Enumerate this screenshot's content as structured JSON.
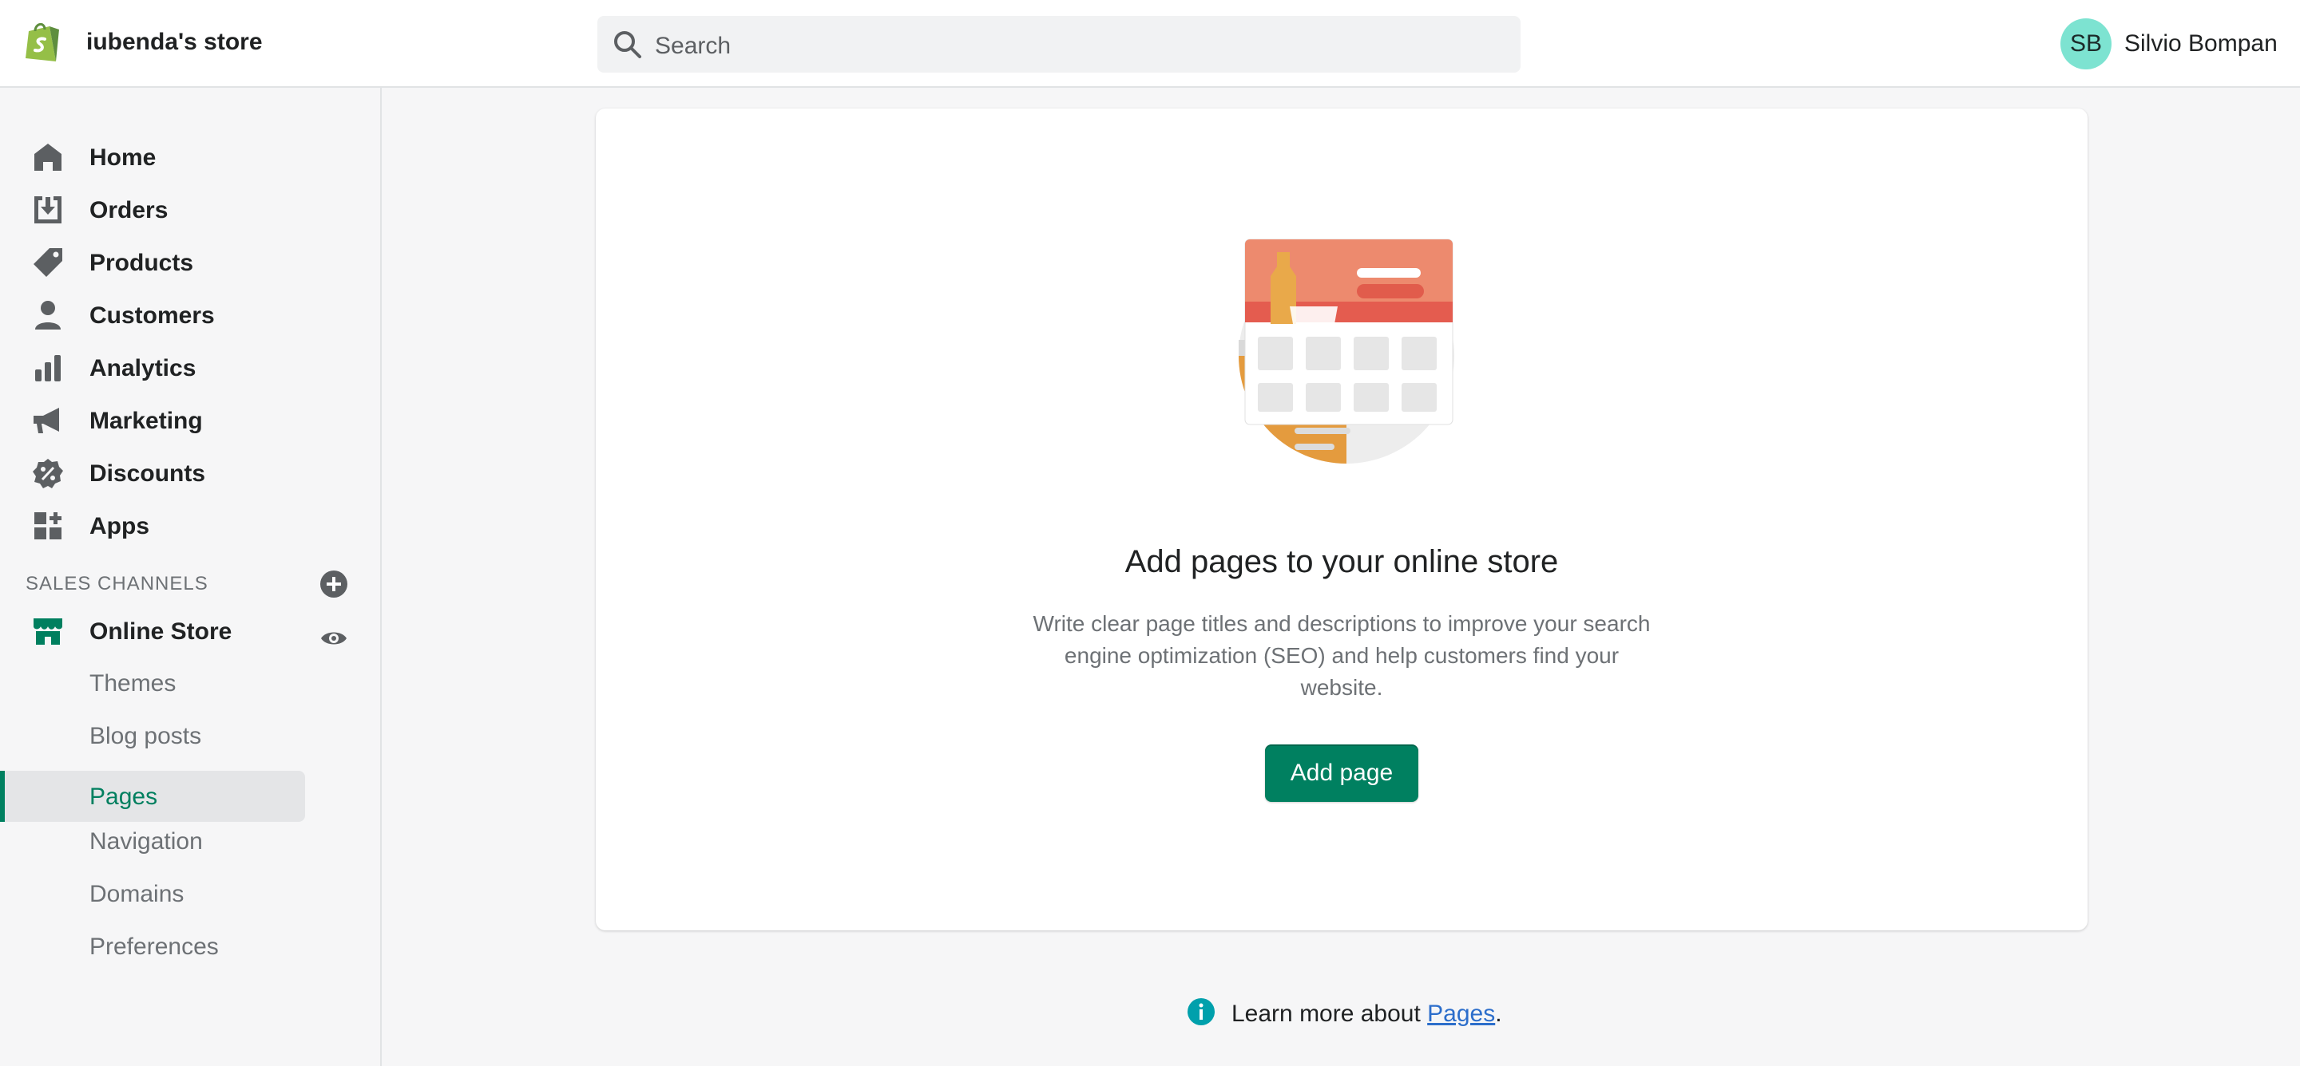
{
  "header": {
    "store_name": "iubenda's store",
    "search_placeholder": "Search",
    "user_initials": "SB",
    "user_name": "Silvio Bompan"
  },
  "sidebar": {
    "items": [
      {
        "label": "Home",
        "icon": "home-icon"
      },
      {
        "label": "Orders",
        "icon": "orders-icon"
      },
      {
        "label": "Products",
        "icon": "tag-icon"
      },
      {
        "label": "Customers",
        "icon": "person-icon"
      },
      {
        "label": "Analytics",
        "icon": "bar-chart-icon"
      },
      {
        "label": "Marketing",
        "icon": "megaphone-icon"
      },
      {
        "label": "Discounts",
        "icon": "discount-icon"
      },
      {
        "label": "Apps",
        "icon": "apps-icon"
      }
    ],
    "section_title": "SALES CHANNELS",
    "channel": {
      "label": "Online Store",
      "icon": "store-icon"
    },
    "sub_items": [
      {
        "label": "Themes"
      },
      {
        "label": "Blog posts"
      },
      {
        "label": "Pages",
        "active": true
      },
      {
        "label": "Navigation"
      },
      {
        "label": "Domains"
      },
      {
        "label": "Preferences"
      }
    ]
  },
  "main": {
    "heading": "Add pages to your online store",
    "description": "Write clear page titles and descriptions to improve your search engine optimization (SEO) and help customers find your website.",
    "button_label": "Add page"
  },
  "footer": {
    "text": "Learn more about ",
    "link": "Pages",
    "suffix": "."
  },
  "colors": {
    "accent": "#008060",
    "active_text": "#007f5f",
    "avatar_bg": "#7de3d1",
    "link": "#2c6ecb"
  }
}
